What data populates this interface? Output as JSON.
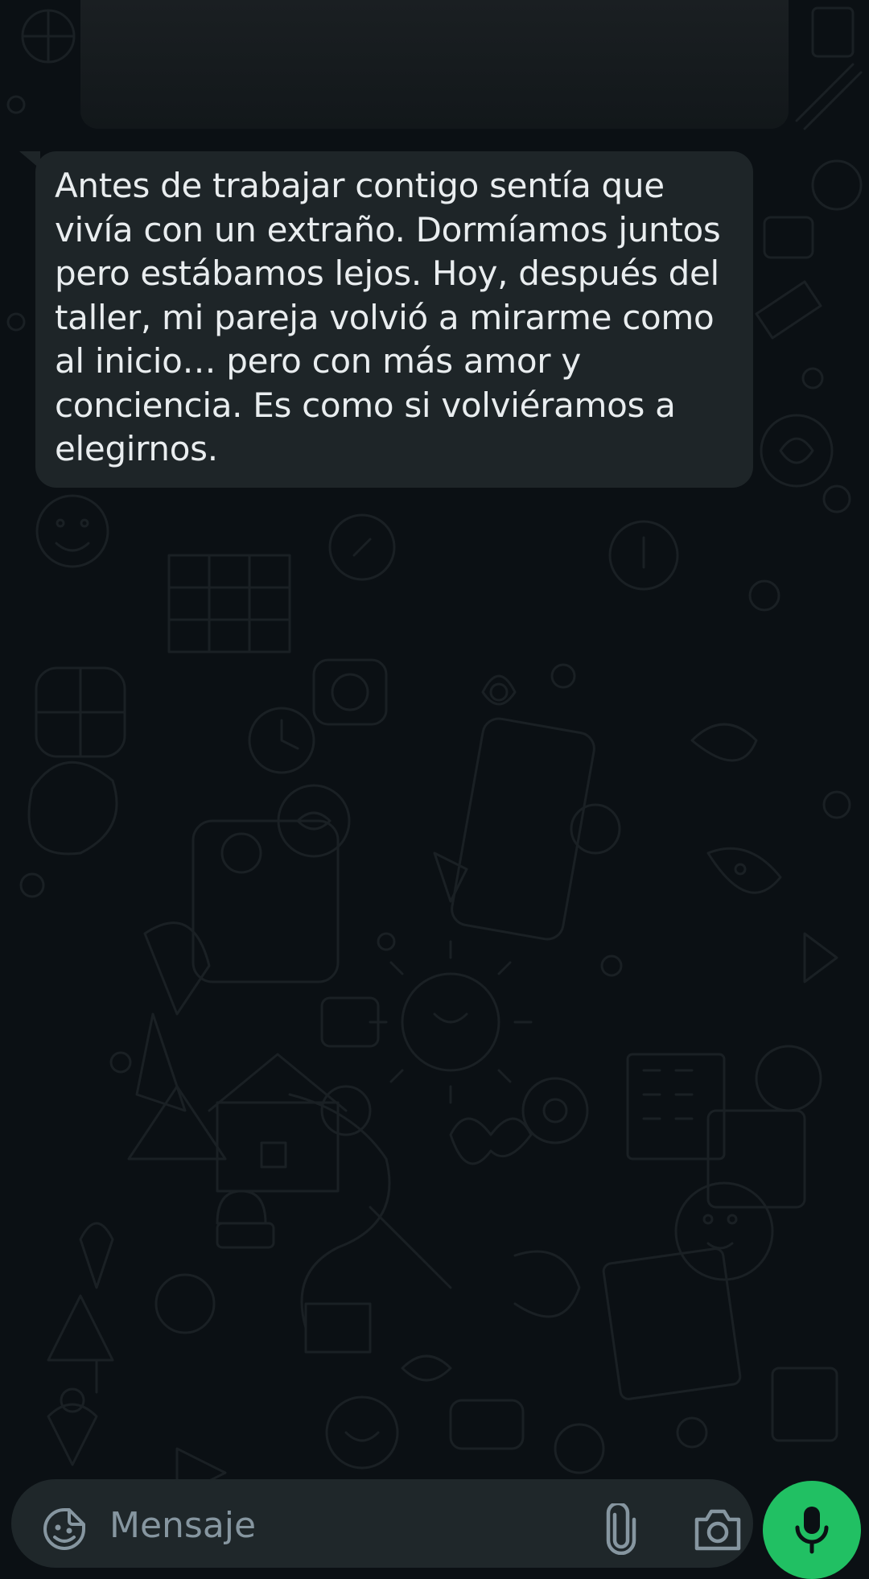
{
  "chat": {
    "message": {
      "text": "Antes de trabajar contigo sentía que vivía con un extraño. Dormíamos juntos pero estábamos lejos. Hoy, después del taller, mi pareja volvió a mirarme como al inicio… pero con más amor y conciencia. Es como si volviéramos a elegirnos."
    }
  },
  "composer": {
    "placeholder": "Mensaje",
    "icons": {
      "emoji": "sticker-emoji-icon",
      "attach": "paperclip-icon",
      "camera": "camera-icon",
      "mic": "microphone-icon"
    }
  },
  "colors": {
    "background": "#0b1014",
    "bubble": "#1e2528",
    "text": "#e9edef",
    "placeholder": "#8696a0",
    "input": "#1f272a",
    "accent": "#21c063"
  }
}
